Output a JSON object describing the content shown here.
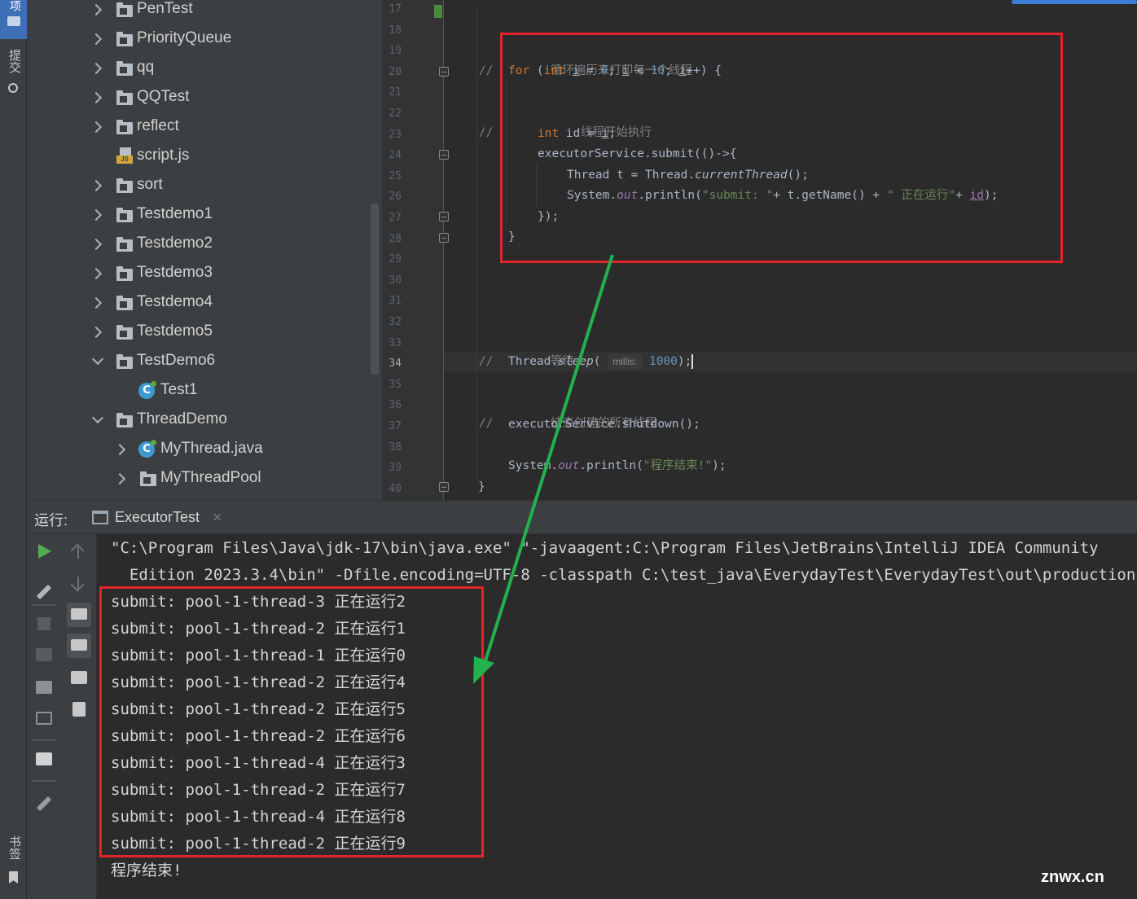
{
  "left_strip": {
    "top_tab_label": "项",
    "commit_label": "提交",
    "bookmarks_label": "书签"
  },
  "project_tree": {
    "items": [
      {
        "label": "PenTest",
        "icon": "folder-icon",
        "expander": "right"
      },
      {
        "label": "PriorityQueue",
        "icon": "folder-icon",
        "expander": "right"
      },
      {
        "label": "qq",
        "icon": "folder-icon",
        "expander": "right"
      },
      {
        "label": "QQTest",
        "icon": "folder-icon",
        "expander": "right"
      },
      {
        "label": "reflect",
        "icon": "folder-icon",
        "expander": "right"
      },
      {
        "label": "script.js",
        "icon": "js-file-icon",
        "expander": "none"
      },
      {
        "label": "sort",
        "icon": "folder-icon",
        "expander": "right"
      },
      {
        "label": "Testdemo1",
        "icon": "folder-icon",
        "expander": "right"
      },
      {
        "label": "Testdemo2",
        "icon": "folder-icon",
        "expander": "right"
      },
      {
        "label": "Testdemo3",
        "icon": "folder-icon",
        "expander": "right"
      },
      {
        "label": "Testdemo4",
        "icon": "folder-icon",
        "expander": "right"
      },
      {
        "label": "Testdemo5",
        "icon": "folder-icon",
        "expander": "right"
      },
      {
        "label": "TestDemo6",
        "icon": "folder-icon",
        "expander": "down"
      },
      {
        "label": "Test1",
        "icon": "java-class-icon",
        "expander": "none"
      },
      {
        "label": "ThreadDemo",
        "icon": "folder-icon",
        "expander": "down"
      },
      {
        "label": "MyThread.java",
        "icon": "java-class-icon",
        "expander": "right"
      },
      {
        "label": "MyThreadPool",
        "icon": "folder-icon",
        "expander": "right"
      }
    ]
  },
  "editor": {
    "line_numbers": [
      "17",
      "18",
      "19",
      "20",
      "21",
      "22",
      "23",
      "24",
      "25",
      "26",
      "27",
      "28",
      "29",
      "30",
      "31",
      "32",
      "33",
      "34",
      "35",
      "36",
      "37",
      "38",
      "39",
      "40"
    ],
    "current_line": "34",
    "code": {
      "l19_cmt": "//",
      "l19_text": "循环遍历来打印每一个线程",
      "l20_kw1": "for",
      "l20_a": " (",
      "l20_kw2": "int",
      "l20_b": " ",
      "l20_i1": "i",
      "l20_c": " = ",
      "l20_n0": "0",
      "l20_d": "; ",
      "l20_i2": "i",
      "l20_e": " < ",
      "l20_n10": "10",
      "l20_f": "; ",
      "l20_i3": "i",
      "l20_g": "++) {",
      "l22_cmt": "//",
      "l22_text": "线程开始执行",
      "l23_kw": "int",
      "l23_a": " id = ",
      "l23_i": "i",
      "l23_b": ";",
      "l24": "executorService.submit(()->{",
      "l25_a": "Thread t = Thread.",
      "l25_m": "currentThread",
      "l25_b": "();",
      "l26_a": "System.",
      "l26_f": "out",
      "l26_b": ".println(",
      "l26_s1": "\"submit: \"",
      "l26_c": "+ t.getName() + ",
      "l26_s2": "\" 正在运行\"",
      "l26_d": "+ ",
      "l26_id": "id",
      "l26_e": ");",
      "l27": "});",
      "l28": "}",
      "l33_cmt": "//",
      "l33_text": "等待",
      "l34_a": "Thread.",
      "l34_m": "sleep",
      "l34_b": "( ",
      "l34_hint": "millis:",
      "l34_n": "1000",
      "l34_c": ");",
      "l36_cmt": "//",
      "l36_text": "结束创建的所有线程",
      "l37": "executorService.shutdown();",
      "l39_a": "System.",
      "l39_f": "out",
      "l39_b": ".println(",
      "l39_s": "\"程序结束!\"",
      "l39_c": ");",
      "l40": "}"
    }
  },
  "run_panel": {
    "label": "运行:",
    "tab_label": "ExecutorTest",
    "tab_close": "×",
    "console": {
      "command_line_1": "\"C:\\Program Files\\Java\\jdk-17\\bin\\java.exe\" \"-javaagent:C:\\Program Files\\JetBrains\\IntelliJ IDEA Community",
      "command_line_2": "  Edition 2023.3.4\\bin\" -Dfile.encoding=UTF-8 -classpath C:\\test_java\\EverydayTest\\EverydayTest\\out\\production",
      "output": [
        "submit: pool-1-thread-3 正在运行2",
        "submit: pool-1-thread-2 正在运行1",
        "submit: pool-1-thread-1 正在运行0",
        "submit: pool-1-thread-2 正在运行4",
        "submit: pool-1-thread-2 正在运行5",
        "submit: pool-1-thread-2 正在运行6",
        "submit: pool-1-thread-4 正在运行3",
        "submit: pool-1-thread-2 正在运行7",
        "submit: pool-1-thread-4 正在运行8",
        "submit: pool-1-thread-2 正在运行9"
      ],
      "end_line": "程序结束!"
    }
  },
  "annotations": {
    "highlight_color": "#e3242b",
    "arrow_color": "#22b14c"
  },
  "watermark": "znwx.cn"
}
